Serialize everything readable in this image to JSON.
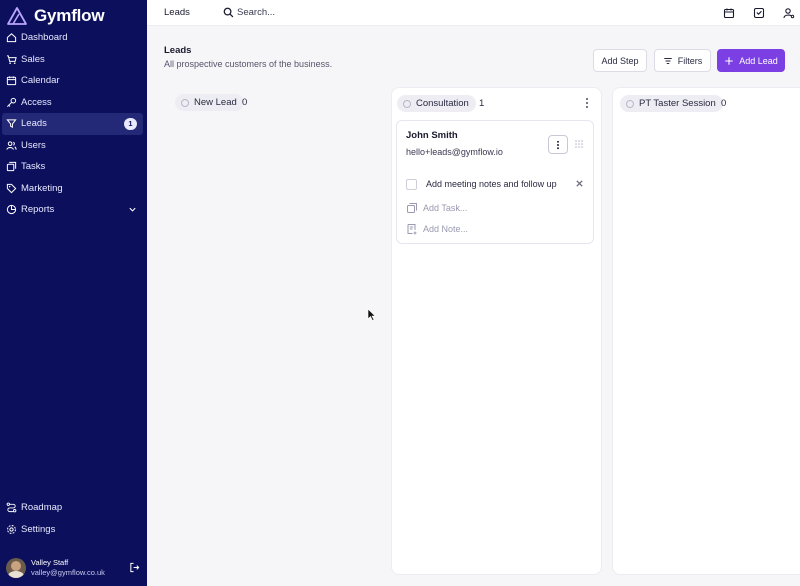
{
  "brand": {
    "name": "Gymflow"
  },
  "sidebar": {
    "items": [
      {
        "label": "Dashboard",
        "icon": "home-icon"
      },
      {
        "label": "Sales",
        "icon": "cart-icon"
      },
      {
        "label": "Calendar",
        "icon": "calendar-icon"
      },
      {
        "label": "Access",
        "icon": "key-icon"
      },
      {
        "label": "Leads",
        "icon": "filter-icon",
        "badge": "1",
        "active": true
      },
      {
        "label": "Users",
        "icon": "users-icon"
      },
      {
        "label": "Tasks",
        "icon": "tasks-icon"
      },
      {
        "label": "Marketing",
        "icon": "tag-icon"
      },
      {
        "label": "Reports",
        "icon": "pie-chart-icon",
        "expandable": true
      }
    ],
    "bottom_items": [
      {
        "label": "Roadmap",
        "icon": "route-icon"
      },
      {
        "label": "Settings",
        "icon": "gear-icon"
      }
    ],
    "user": {
      "name": "Valley Staff",
      "email": "valley@gymflow.co.uk"
    }
  },
  "topbar": {
    "title": "Leads",
    "search_placeholder": "Search..."
  },
  "page": {
    "title": "Leads",
    "subtitle": "All prospective customers of the business.",
    "buttons": {
      "add_step": "Add Step",
      "filters": "Filters",
      "add_lead": "Add Lead"
    }
  },
  "board": {
    "columns": [
      {
        "stage": "New Lead",
        "count": "0"
      },
      {
        "stage": "Consultation",
        "count": "1"
      },
      {
        "stage": "PT Taster Session",
        "count": "0"
      }
    ],
    "card": {
      "name": "John Smith",
      "email": "hello+leads@gymflow.io",
      "task": "Add meeting notes and follow up",
      "add_task": "Add Task...",
      "add_note": "Add Note..."
    }
  },
  "colors": {
    "sidebar_bg": "#0b0f5c",
    "accent": "#7b3fe4"
  }
}
